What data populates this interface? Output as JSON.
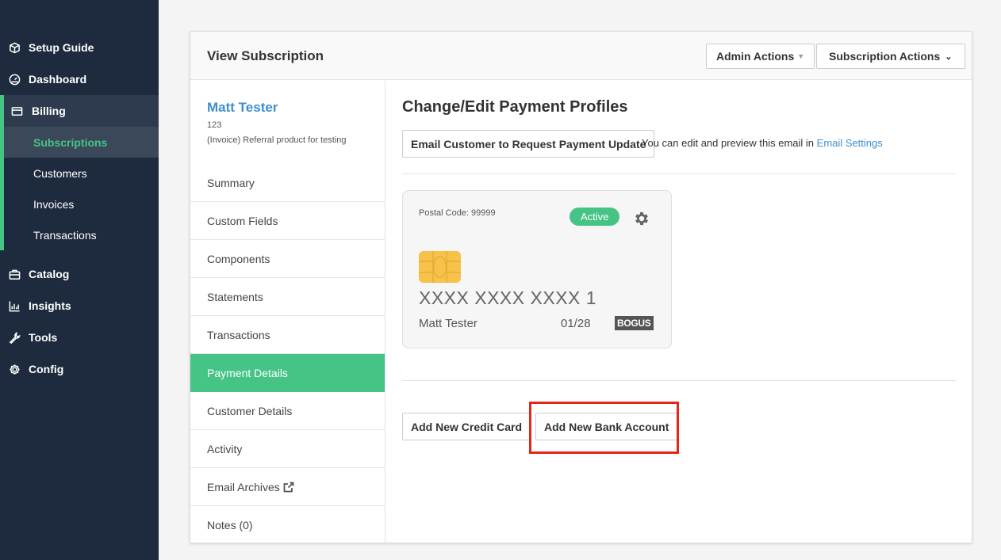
{
  "sidebar": {
    "items": [
      {
        "label": "Setup Guide",
        "icon": "box-icon"
      },
      {
        "label": "Dashboard",
        "icon": "gauge-icon"
      },
      {
        "label": "Billing",
        "icon": "credit-card-icon"
      },
      {
        "label": "Catalog",
        "icon": "briefcase-icon"
      },
      {
        "label": "Insights",
        "icon": "bar-chart-icon"
      },
      {
        "label": "Tools",
        "icon": "wrench-icon"
      },
      {
        "label": "Config",
        "icon": "gear-icon"
      }
    ],
    "billing_sub": [
      "Subscriptions",
      "Customers",
      "Invoices",
      "Transactions"
    ]
  },
  "header": {
    "title": "View Subscription",
    "admin_actions": "Admin Actions",
    "subscription_actions": "Subscription Actions"
  },
  "customer": {
    "name": "Matt Tester",
    "id": "123",
    "product": "(Invoice) Referral product for testing"
  },
  "tabs": [
    "Summary",
    "Custom Fields",
    "Components",
    "Statements",
    "Transactions",
    "Payment Details",
    "Customer Details",
    "Activity",
    "Email Archives",
    "Notes (0)"
  ],
  "content": {
    "title": "Change/Edit Payment Profiles",
    "email_button": "Email Customer to Request Payment Update",
    "email_note": "You can edit and preview this email in ",
    "email_link": "Email Settings"
  },
  "card": {
    "postal": "Postal Code: 99999",
    "status": "Active",
    "number": "XXXX XXXX XXXX 1",
    "holder": "Matt Tester",
    "expiry": "01/28",
    "brand": "BOGUS"
  },
  "actions": {
    "add_card": "Add New Credit Card",
    "add_bank": "Add New Bank Account"
  },
  "colors": {
    "sidebar_bg": "#1e2b3e",
    "accent_green": "#45c486",
    "link_blue": "#3d8fd1",
    "highlight_red": "#e32718"
  }
}
